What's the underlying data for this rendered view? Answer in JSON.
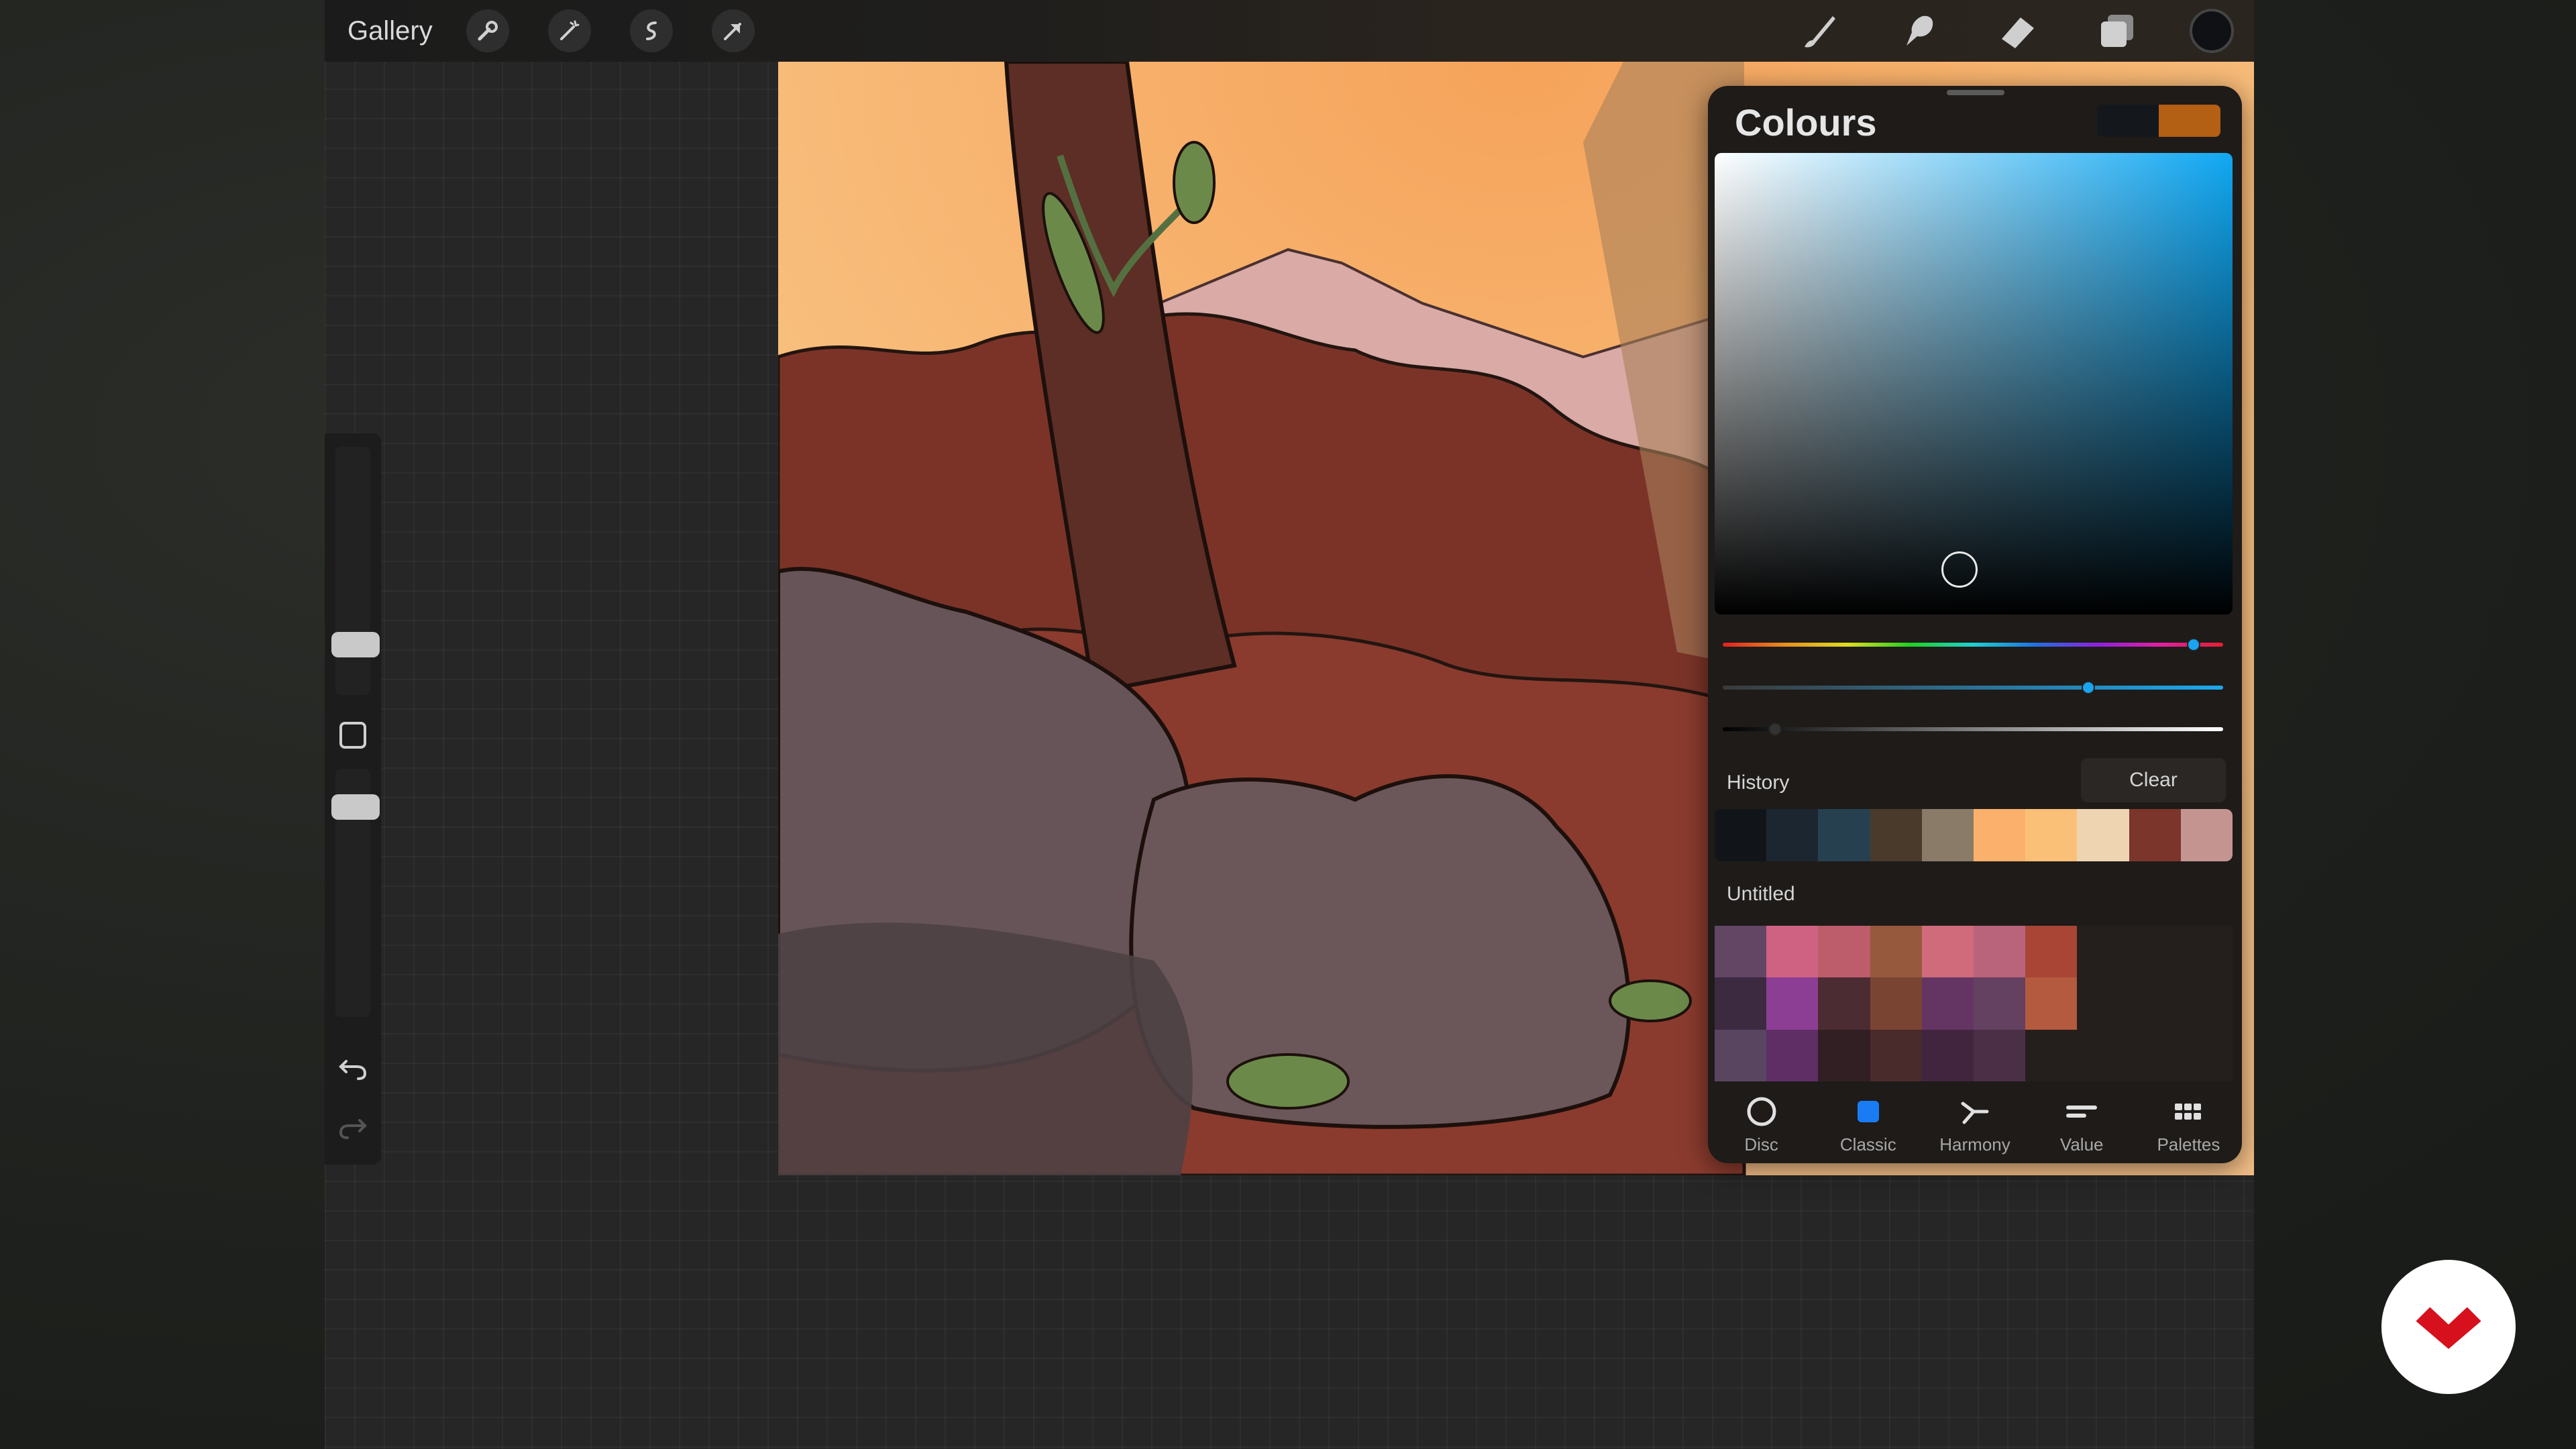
{
  "topbar": {
    "gallery_label": "Gallery",
    "left_tools": [
      "wrench-icon",
      "magic-wand-icon",
      "selection-icon",
      "transform-arrow-icon"
    ],
    "right_tools": [
      "brush-icon",
      "smudge-icon",
      "eraser-icon",
      "layers-icon"
    ],
    "current_color": "#0f1114"
  },
  "colours_panel": {
    "title": "Colours",
    "previous_color": "#14181d",
    "current_color": "#b35f14",
    "picker_hue_color": "#10a8f3",
    "history_label": "History",
    "clear_label": "Clear",
    "history_colors": [
      "#111519",
      "#1c2630",
      "#27404f",
      "#4a3a2c",
      "#8a7a68",
      "#fbb06b",
      "#fbc078",
      "#efd4b2",
      "#7b352b",
      "#c49590"
    ],
    "palette_label": "Untitled",
    "palette_rows": [
      [
        "#624664",
        "#cf6283",
        "#bd5c6a",
        "#96593e",
        "#cf6b7b",
        "#b9647a",
        "#a84535",
        "",
        "",
        ""
      ],
      [
        "#3c2a40",
        "#8c3e95",
        "#4c2c33",
        "#7a4433",
        "#643563",
        "#644061",
        "#b45a3e",
        "",
        "",
        ""
      ],
      [
        "#5a4560",
        "#5e2e65",
        "#321f23",
        "#4a2b2c",
        "#41253f",
        "#4b2f47",
        "",
        "",
        "",
        ""
      ]
    ],
    "tabs": [
      {
        "label": "Disc",
        "icon": "disc-icon"
      },
      {
        "label": "Classic",
        "icon": "classic-square-icon"
      },
      {
        "label": "Harmony",
        "icon": "harmony-icon"
      },
      {
        "label": "Value",
        "icon": "value-sliders-icon"
      },
      {
        "label": "Palettes",
        "icon": "palettes-grid-icon"
      }
    ],
    "active_tab": "Classic"
  },
  "sidebar": {
    "tools": [
      "brush-size-slider",
      "modify-button",
      "opacity-slider",
      "undo-icon",
      "redo-icon"
    ]
  },
  "colors": {
    "accent": "#1a8cff",
    "logo_red": "#d6101d"
  }
}
